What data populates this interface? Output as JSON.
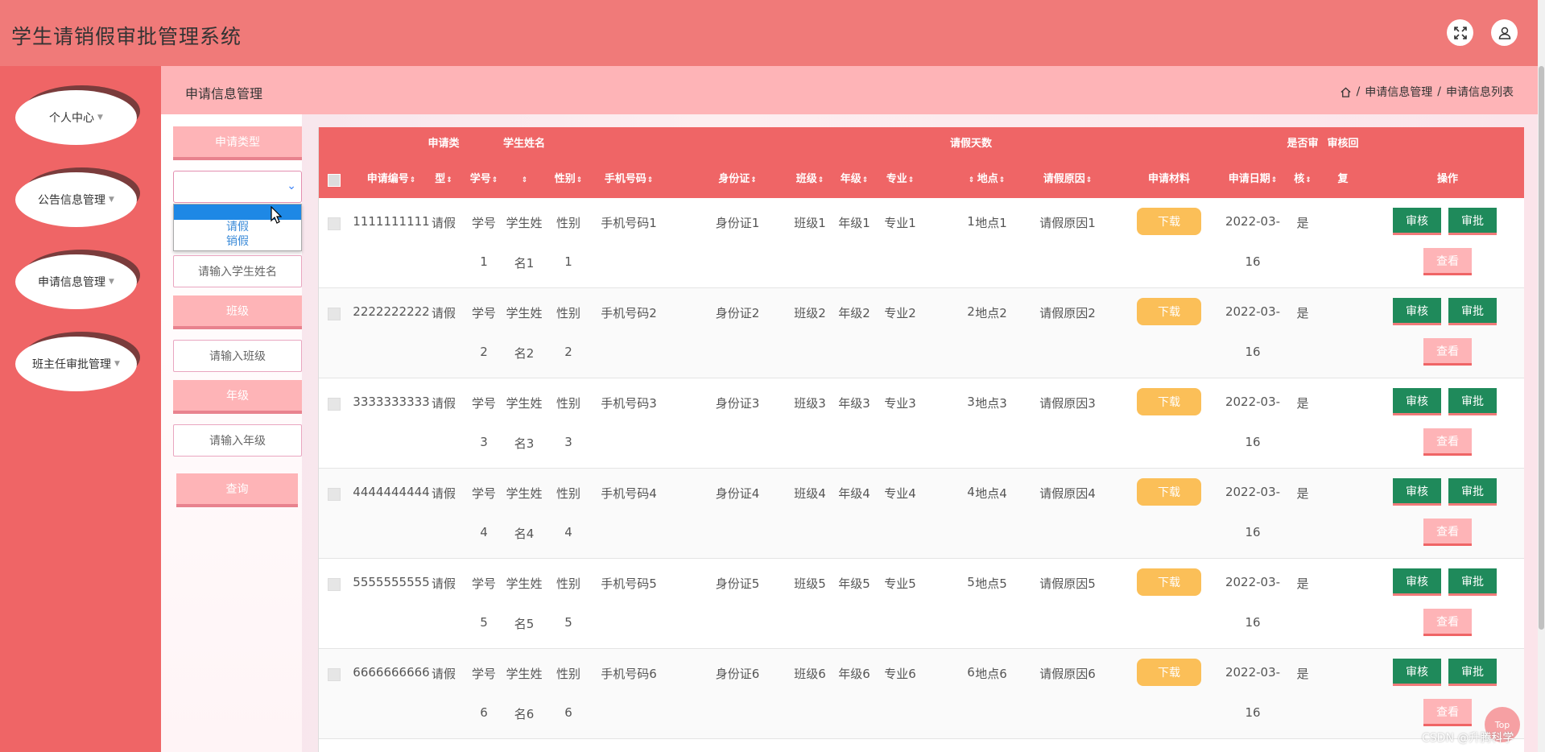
{
  "header": {
    "title": "学生请销假审批管理系统"
  },
  "sidebar": {
    "items": [
      {
        "label": "个人中心"
      },
      {
        "label": "公告信息管理"
      },
      {
        "label": "申请信息管理"
      },
      {
        "label": "班主任审批管理"
      }
    ]
  },
  "subheader": {
    "title": "申请信息管理",
    "breadcrumb": [
      "申请信息管理",
      "申请信息列表"
    ],
    "separator": "/"
  },
  "filters": {
    "type_label": "申请类型",
    "type_options": [
      "请假",
      "销假"
    ],
    "name_placeholder": "请输入学生姓名",
    "class_label": "班级",
    "class_placeholder": "请输入班级",
    "grade_label": "年级",
    "grade_placeholder": "请输入年级",
    "search_label": "查询"
  },
  "table": {
    "headers": {
      "apply_no": "申请编号",
      "type_top": "申请类",
      "type_bot": "型",
      "student_no": "学号",
      "name_top": "学生姓名",
      "gender": "性别",
      "phone": "手机号码",
      "idcard": "身份证",
      "class": "班级",
      "grade": "年级",
      "major": "专业",
      "days_top": "请假天数",
      "place": "地点",
      "reason": "请假原因",
      "material": "申请材料",
      "date": "申请日期",
      "audit_top": "是否审",
      "audit_bot": "核",
      "reply_top": "审核回",
      "reply_bot": "复",
      "ops": "操作"
    },
    "buttons": {
      "download": "下载",
      "audit": "审核",
      "approve": "审批",
      "view": "查看"
    },
    "rows": [
      {
        "apply_no": "1111111111",
        "type": "请假",
        "sno_a": "学号",
        "sno_b": "1",
        "name_a": "学生姓",
        "name_b": "名1",
        "gender_a": "性别",
        "gender_b": "1",
        "phone": "手机号码1",
        "idcard": "身份证1",
        "class": "班级1",
        "grade": "年级1",
        "major": "专业1",
        "days": "1",
        "place": "地点1",
        "reason": "请假原因1",
        "date_a": "2022-03-",
        "date_b": "16",
        "audit": "是"
      },
      {
        "apply_no": "2222222222",
        "type": "请假",
        "sno_a": "学号",
        "sno_b": "2",
        "name_a": "学生姓",
        "name_b": "名2",
        "gender_a": "性别",
        "gender_b": "2",
        "phone": "手机号码2",
        "idcard": "身份证2",
        "class": "班级2",
        "grade": "年级2",
        "major": "专业2",
        "days": "2",
        "place": "地点2",
        "reason": "请假原因2",
        "date_a": "2022-03-",
        "date_b": "16",
        "audit": "是"
      },
      {
        "apply_no": "3333333333",
        "type": "请假",
        "sno_a": "学号",
        "sno_b": "3",
        "name_a": "学生姓",
        "name_b": "名3",
        "gender_a": "性别",
        "gender_b": "3",
        "phone": "手机号码3",
        "idcard": "身份证3",
        "class": "班级3",
        "grade": "年级3",
        "major": "专业3",
        "days": "3",
        "place": "地点3",
        "reason": "请假原因3",
        "date_a": "2022-03-",
        "date_b": "16",
        "audit": "是"
      },
      {
        "apply_no": "4444444444",
        "type": "请假",
        "sno_a": "学号",
        "sno_b": "4",
        "name_a": "学生姓",
        "name_b": "名4",
        "gender_a": "性别",
        "gender_b": "4",
        "phone": "手机号码4",
        "idcard": "身份证4",
        "class": "班级4",
        "grade": "年级4",
        "major": "专业4",
        "days": "4",
        "place": "地点4",
        "reason": "请假原因4",
        "date_a": "2022-03-",
        "date_b": "16",
        "audit": "是"
      },
      {
        "apply_no": "5555555555",
        "type": "请假",
        "sno_a": "学号",
        "sno_b": "5",
        "name_a": "学生姓",
        "name_b": "名5",
        "gender_a": "性别",
        "gender_b": "5",
        "phone": "手机号码5",
        "idcard": "身份证5",
        "class": "班级5",
        "grade": "年级5",
        "major": "专业5",
        "days": "5",
        "place": "地点5",
        "reason": "请假原因5",
        "date_a": "2022-03-",
        "date_b": "16",
        "audit": "是"
      },
      {
        "apply_no": "6666666666",
        "type": "请假",
        "sno_a": "学号",
        "sno_b": "6",
        "name_a": "学生姓",
        "name_b": "名6",
        "gender_a": "性别",
        "gender_b": "6",
        "phone": "手机号码6",
        "idcard": "身份证6",
        "class": "班级6",
        "grade": "年级6",
        "major": "专业6",
        "days": "6",
        "place": "地点6",
        "reason": "请假原因6",
        "date_a": "2022-03-",
        "date_b": "16",
        "audit": "是"
      }
    ]
  },
  "misc": {
    "top_label": "Top",
    "watermark": "CSDN @升腾科学"
  },
  "colors": {
    "header": "#f07a79",
    "sidebar": "#ef6566",
    "accent_light": "#feb4b7",
    "download": "#fbbf58",
    "approve_green": "#1f8a5b"
  }
}
